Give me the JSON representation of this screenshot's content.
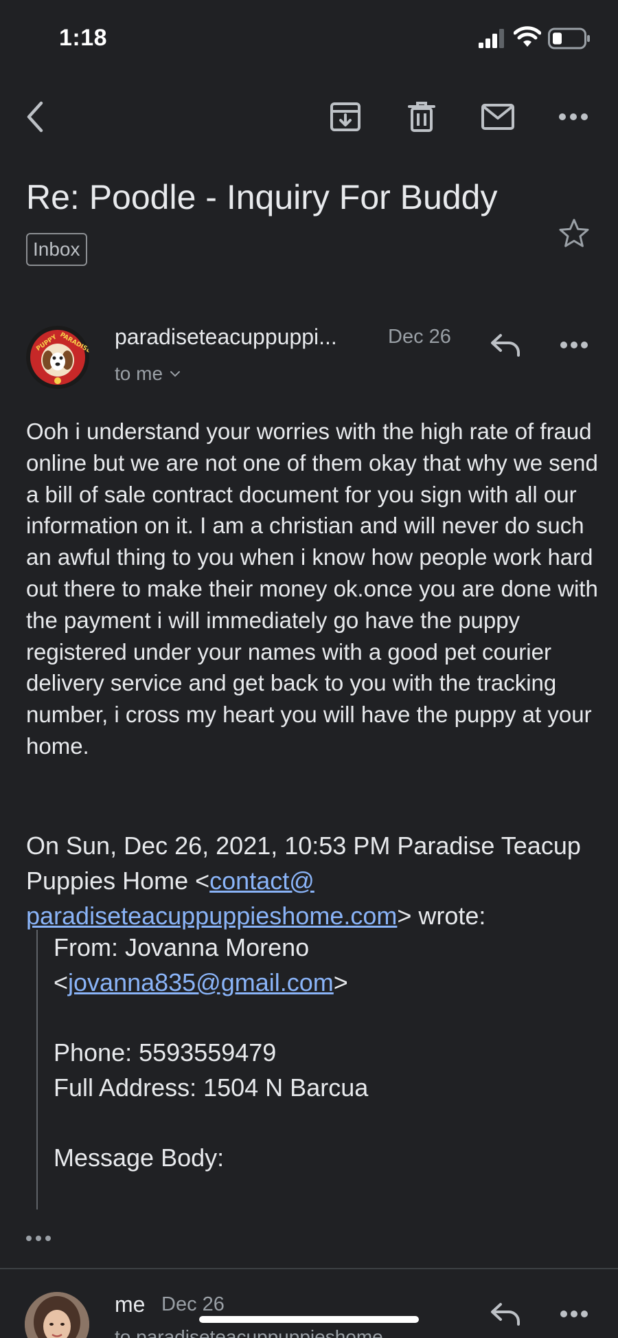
{
  "status_bar": {
    "time": "1:18",
    "icons": [
      "signal-icon",
      "wifi-icon",
      "battery-icon"
    ]
  },
  "toolbar": {
    "icons": [
      "back-arrow-icon",
      "archive-icon",
      "trash-icon",
      "mail-icon",
      "more-horizontal-icon"
    ]
  },
  "email": {
    "subject": "Re: Poodle - Inquiry For Buddy",
    "label": "Inbox",
    "starred": false
  },
  "messages": [
    {
      "sender": "paradiseteacuppuppi...",
      "date": "Dec 26",
      "to": "to me",
      "avatar_text": "PUPPY PARADISE",
      "body": "Ooh i understand your worries with the high rate of fraud online but we are not one of them okay that why we send a bill of sale contract document for you sign with all our information on it. I am a christian and will never do such an awful thing to you when i know how people work hard out there to make their money ok.once you are done with the payment i will immediately go have the puppy registered under your names with a good pet courier delivery service and get back to you with the tracking number, i cross my heart you will have the puppy at your home.",
      "quote_intro": "On Sun, Dec 26, 2021, 10:53 PM Paradise Teacup Puppies Home <",
      "quote_link": "contact@ paradiseteacuppuppieshome.com",
      "quote_outro": "> wrote:",
      "quoted": {
        "from_label": "From: Jovanna Moreno",
        "from_email": "jovanna835@gmail.com",
        "phone": "Phone: 5593559479",
        "address": "Full Address: 1504 N Barcua",
        "message_body": "Message Body:"
      }
    },
    {
      "sender": "me",
      "date": "Dec 26",
      "to": "to paradiseteacuppuppieshome"
    }
  ],
  "colors": {
    "background": "#202124",
    "text": "#e8eaed",
    "secondary_text": "#9aa0a6",
    "link": "#8ab4f8",
    "avatar_red": "#c62828"
  }
}
